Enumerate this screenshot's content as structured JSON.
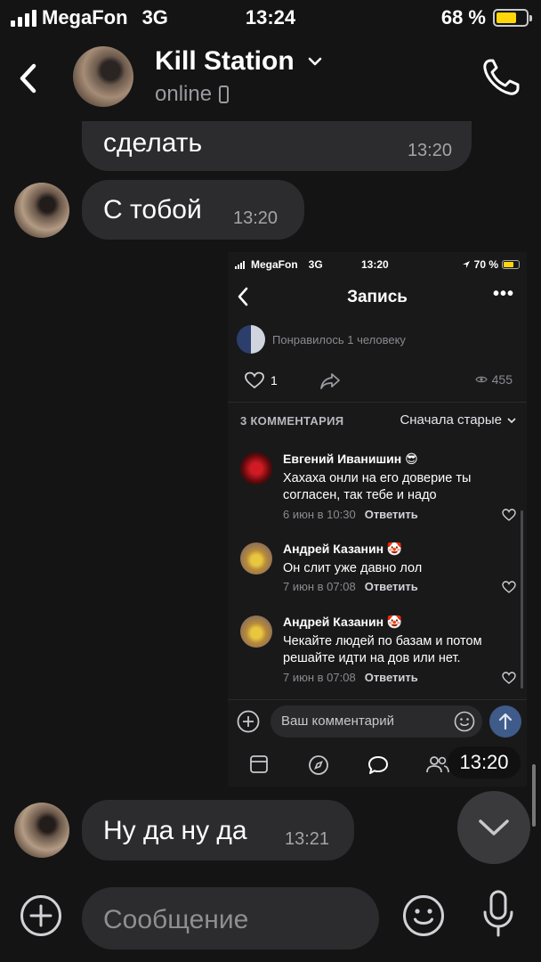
{
  "status_bar": {
    "carrier": "MegaFon",
    "network": "3G",
    "time": "13:24",
    "battery": "68 %",
    "battery_level": 0.68
  },
  "header": {
    "title": "Kill Station",
    "status": "online"
  },
  "messages": [
    {
      "text": "сделать",
      "time": "13:20"
    },
    {
      "text": "С тобой",
      "time": "13:20"
    },
    {
      "text": "Ну да ну да",
      "time": "13:21"
    }
  ],
  "screenshot": {
    "status": {
      "carrier": "MegaFon",
      "network": "3G",
      "time": "13:20",
      "battery": "70 %"
    },
    "title": "Запись",
    "more": "•••",
    "liked_by": "Понравилось 1 человеку",
    "likes": "1",
    "views": "455",
    "comments_count": "3 КОММЕНТАРИЯ",
    "sort": "Сначала старые",
    "comments": [
      {
        "name": "Евгений Иванишин 😎",
        "text": "Хахаха онли на его доверие ты согласен, так тебе и надо",
        "date": "6 июн в 10:30",
        "reply": "Ответить"
      },
      {
        "name": "Андрей Казанин 🤡",
        "text": "Он слит уже давно лол",
        "date": "7 июн в 07:08",
        "reply": "Ответить"
      },
      {
        "name": "Андрей Казанин 🤡",
        "text": "Чекайте людей по базам и потом решайте идти на дов или нет.",
        "date": "7 июн в 07:08",
        "reply": "Ответить"
      }
    ],
    "comment_placeholder": "Ваш комментарий",
    "timestamp": "13:20"
  },
  "input": {
    "placeholder": "Сообщение"
  },
  "colors": {
    "background": "#141415",
    "bubble": "#2c2c2e",
    "accent_battery": "#ffd60a"
  }
}
